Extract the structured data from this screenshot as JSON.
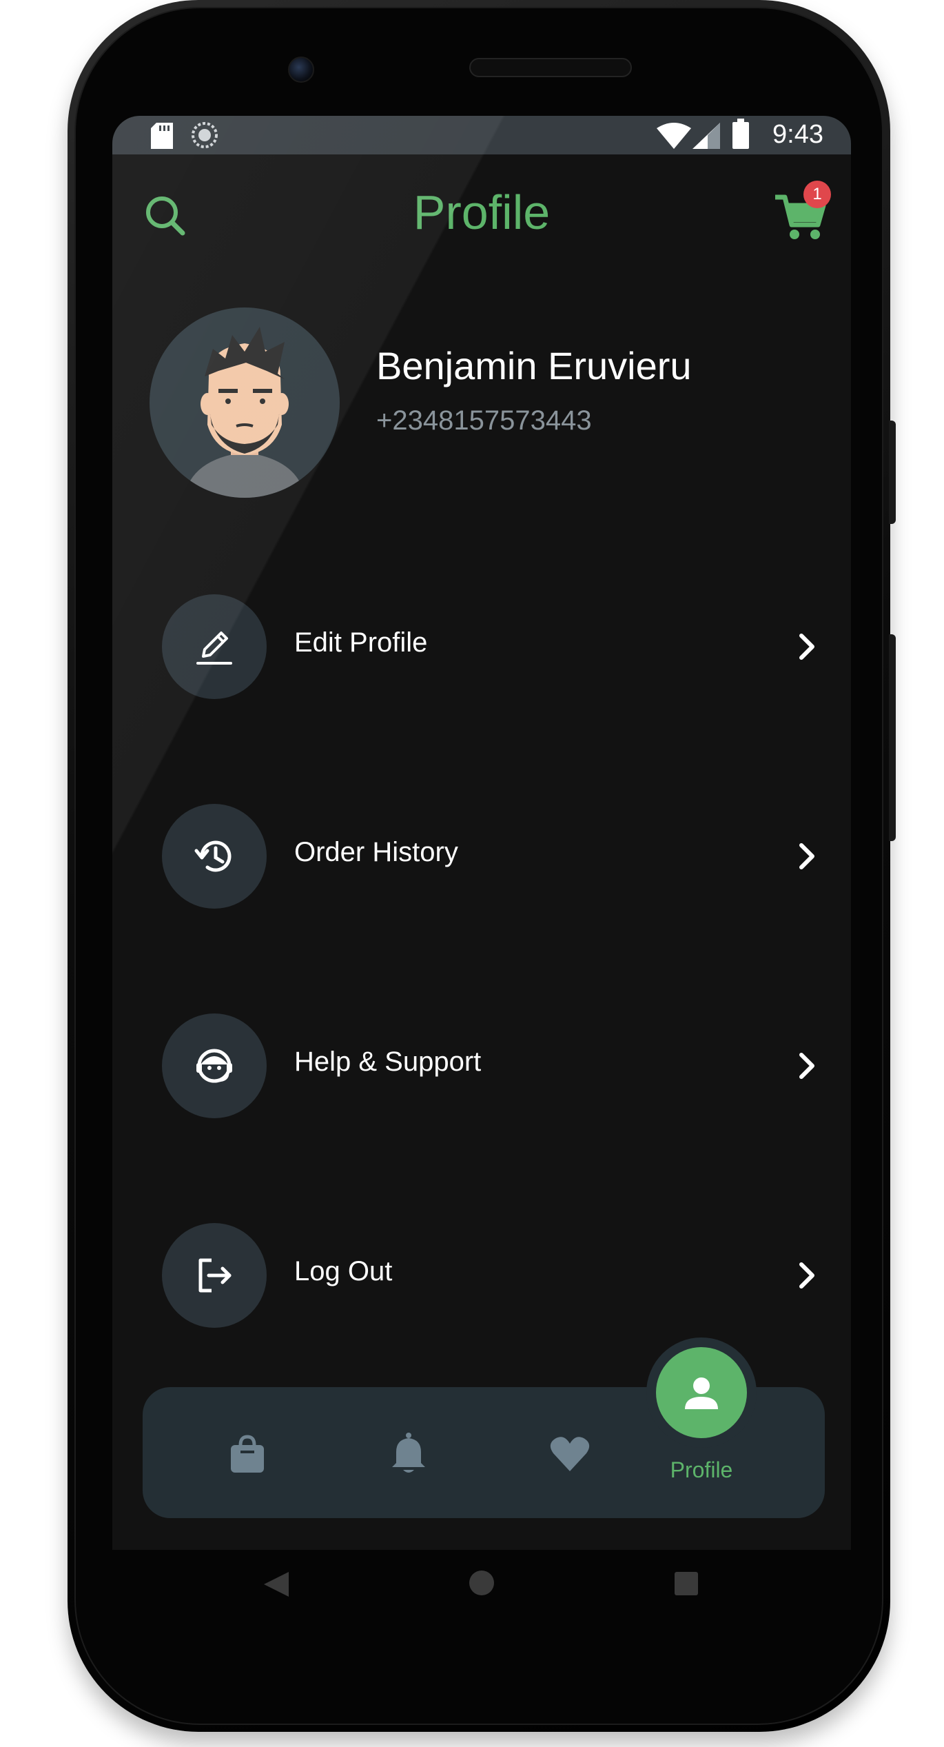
{
  "status_bar": {
    "time": "9:43",
    "icons": [
      "sd-card-icon",
      "sync-icon",
      "wifi-icon",
      "signal-icon",
      "battery-icon"
    ]
  },
  "header": {
    "title": "Profile",
    "search_icon": "search-icon",
    "cart_icon": "cart-icon",
    "cart_count": "1"
  },
  "user": {
    "name": "Benjamin Eruvieru",
    "phone": "+2348157573443"
  },
  "menu": [
    {
      "label": "Edit Profile",
      "icon": "pencil-icon"
    },
    {
      "label": "Order History",
      "icon": "history-icon"
    },
    {
      "label": "Help & Support",
      "icon": "support-agent-icon"
    },
    {
      "label": "Log Out",
      "icon": "logout-icon"
    }
  ],
  "bottom_nav": {
    "items": [
      {
        "icon": "shopping-bag-icon"
      },
      {
        "icon": "bell-icon"
      },
      {
        "icon": "heart-icon"
      },
      {
        "icon": "person-icon",
        "label": "Profile",
        "active": true
      }
    ]
  },
  "colors": {
    "accent": "#5db46a",
    "background": "#121212",
    "card": "#242f35",
    "badge": "#e0474c"
  }
}
